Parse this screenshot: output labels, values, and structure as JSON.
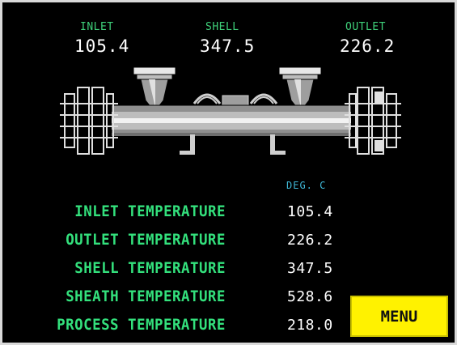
{
  "header": {
    "inlet": {
      "label": "INLET",
      "value": "105.4"
    },
    "shell": {
      "label": "SHELL",
      "value": "347.5"
    },
    "outlet": {
      "label": "OUTLET",
      "value": "226.2"
    }
  },
  "readings": {
    "units": "DEG. C",
    "rows": [
      {
        "label": "INLET  TEMPERATURE",
        "value": "105.4"
      },
      {
        "label": "OUTLET  TEMPERATURE",
        "value": "226.2"
      },
      {
        "label": "SHELL  TEMPERATURE",
        "value": "347.5"
      },
      {
        "label": "SHEATH  TEMPERATURE",
        "value": "528.6"
      },
      {
        "label": "PROCESS  TEMPERATURE",
        "value": "218.0"
      }
    ]
  },
  "menu": {
    "label": "MENU"
  },
  "colors": {
    "label_green": "#33e07c",
    "units_cyan": "#3fb7d6",
    "menu_yellow": "#fff200",
    "background": "#000000"
  },
  "icons": {
    "diagram": "heat-exchanger-diagram"
  }
}
